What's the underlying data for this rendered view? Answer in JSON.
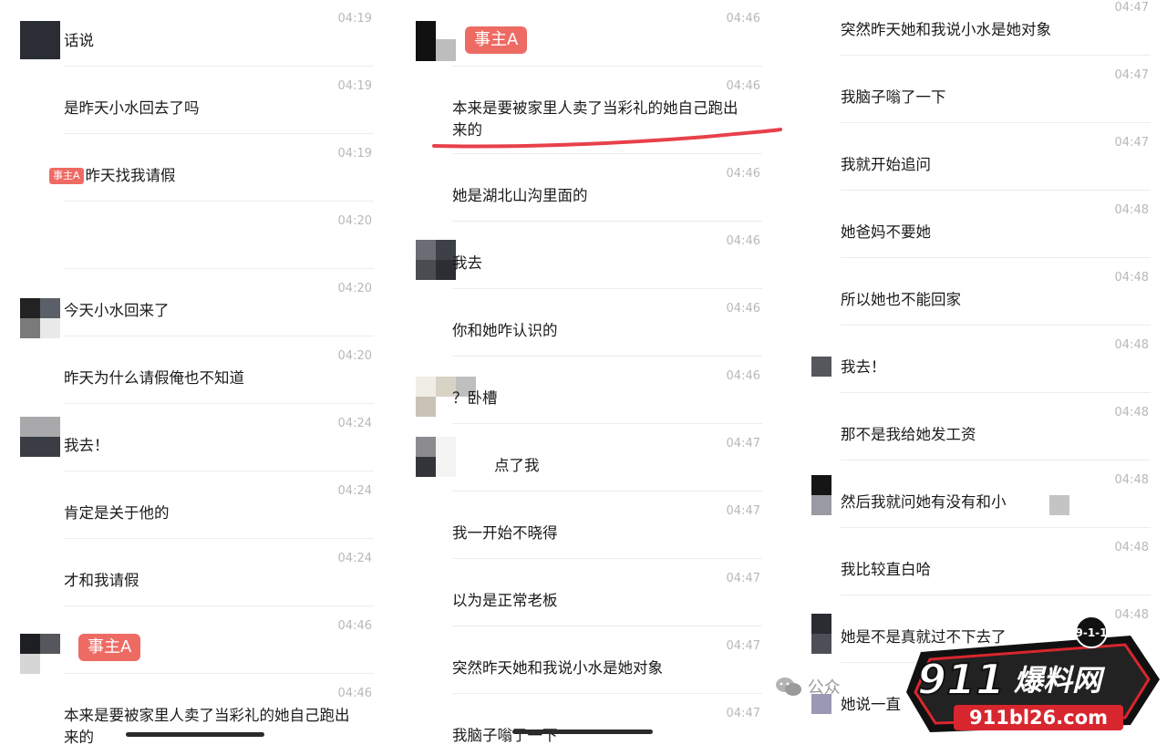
{
  "columns": [
    {
      "messages": [
        {
          "time": "04:19",
          "text": "话说"
        },
        {
          "time": "04:19",
          "text": "是昨天小水回去了吗"
        },
        {
          "time": "04:19",
          "tag": "事主A",
          "text": "昨天找我请假"
        },
        {
          "time": "04:20",
          "text": ""
        },
        {
          "time": "04:20",
          "text": "今天小水回来了"
        },
        {
          "time": "04:20",
          "text": "昨天为什么请假俺也不知道"
        },
        {
          "time": "04:24",
          "text": "我去！"
        },
        {
          "time": "04:24",
          "text": "肯定是关于他的"
        },
        {
          "time": "04:24",
          "text": "才和我请假"
        },
        {
          "time": "04:46",
          "tag": "事主A",
          "text": ""
        },
        {
          "time": "04:46",
          "text": "本来是要被家里人卖了当彩礼的她自己跑出",
          "text2": "来的"
        }
      ]
    },
    {
      "messages": [
        {
          "time": "04:46",
          "tag": "事主A",
          "text": ""
        },
        {
          "time": "04:46",
          "text": "本来是要被家里人卖了当彩礼的她自己跑出",
          "text2": "来的"
        },
        {
          "time": "04:46",
          "text": "她是湖北山沟里面的"
        },
        {
          "time": "04:46",
          "text": "我去"
        },
        {
          "time": "04:46",
          "text": "你和她咋认识的"
        },
        {
          "time": "04:46",
          "text": "？卧槽"
        },
        {
          "time": "04:47",
          "text": "点了我"
        },
        {
          "time": "04:47",
          "text": "我一开始不晓得"
        },
        {
          "time": "04:47",
          "text": "以为是正常老板"
        },
        {
          "time": "04:47",
          "text": "突然昨天她和我说小水是她对象"
        },
        {
          "time": "04:47",
          "text": "我脑子嗡了一下"
        }
      ]
    },
    {
      "messages": [
        {
          "time": "04:47",
          "text": "突然昨天她和我说小水是她对象"
        },
        {
          "time": "04:47",
          "text": "我脑子嗡了一下"
        },
        {
          "time": "04:47",
          "text": "我就开始追问"
        },
        {
          "time": "04:48",
          "text": "她爸妈不要她"
        },
        {
          "time": "04:48",
          "text": "所以她也不能回家"
        },
        {
          "time": "04:48",
          "text": "我去！"
        },
        {
          "time": "04:48",
          "text": "那不是我给她发工资"
        },
        {
          "time": "04:48",
          "text": "然后我就问她有没有和小"
        },
        {
          "time": "04:48",
          "text": "我比较直白哈"
        },
        {
          "time": "04:48",
          "text": "她是不是真就过不下去了"
        },
        {
          "time": "",
          "text": "她说一直"
        }
      ]
    }
  ],
  "watermark": {
    "public": "公众",
    "logo_badge": "9-1-1",
    "logo_number": "911",
    "logo_title": "爆料网",
    "logo_url": "911bl26.com"
  },
  "colors": {
    "accent_tag": "#ee6b64",
    "highlight_line": "#e8404a",
    "time": "#b8b8b8"
  }
}
